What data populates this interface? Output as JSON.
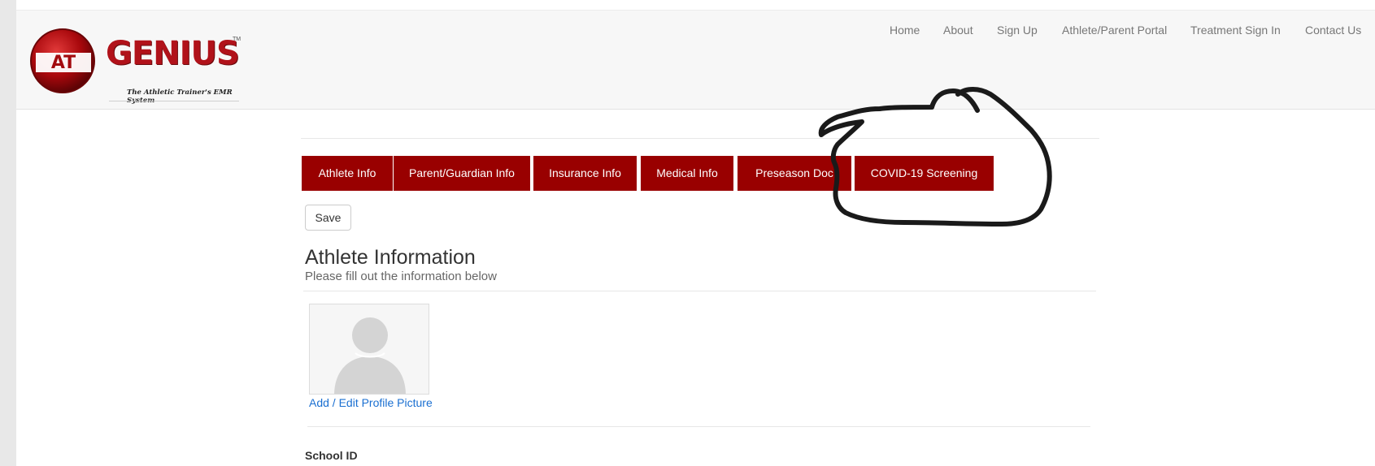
{
  "brand": {
    "logo_badge": "AT",
    "logo_name": "GENIUS",
    "logo_tm": "TM",
    "tagline": "The Athletic Trainer's EMR System"
  },
  "nav": {
    "links": [
      "Home",
      "About",
      "Sign Up",
      "Athlete/Parent Portal",
      "Treatment Sign In",
      "Contact Us"
    ]
  },
  "tabs": [
    "Athlete Info",
    "Parent/Guardian Info",
    "Insurance Info",
    "Medical Info",
    "Preseason Doc",
    "COVID-19 Screening"
  ],
  "form": {
    "save_label": "Save",
    "title": "Athlete Information",
    "subtitle": "Please fill out the information below",
    "profile_link": "Add / Edit Profile Picture",
    "school_id_label": "School ID"
  },
  "colors": {
    "tab_bg": "#990000",
    "link": "#1a6fd1",
    "nav_text": "#777777"
  }
}
